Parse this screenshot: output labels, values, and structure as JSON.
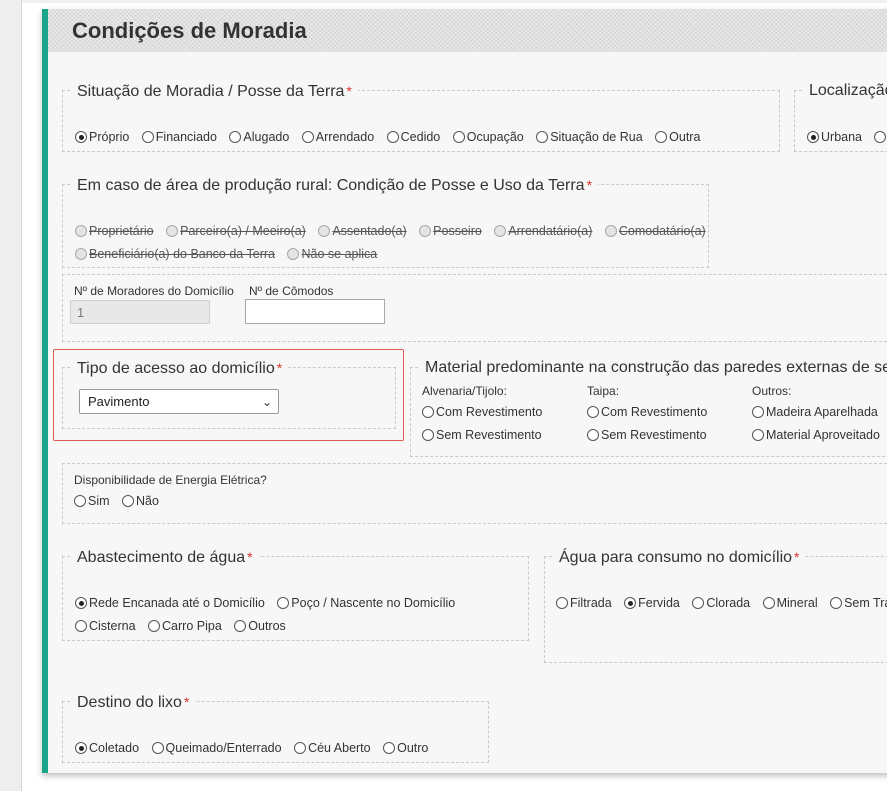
{
  "page_title": "Condições de Moradia",
  "situacao_moradia": {
    "legend": "Situação de Moradia / Posse da Terra",
    "options": [
      "Próprio",
      "Financiado",
      "Alugado",
      "Arrendado",
      "Cedido",
      "Ocupação",
      "Situação de Rua",
      "Outra"
    ],
    "selected": "Próprio"
  },
  "localizacao": {
    "legend": "Localização",
    "options": [
      "Urbana",
      ""
    ],
    "selected": "Urbana"
  },
  "area_rural": {
    "legend": "Em caso de área de produção rural: Condição de Posse e Uso da Terra",
    "options_row1": [
      "Proprietário",
      "Parceiro(a) / Meeiro(a)",
      "Assentado(a)",
      "Posseiro",
      "Arrendatário(a)",
      "Comodatário(a)"
    ],
    "options_row2": [
      "Beneficiário(a) do Banco da Terra",
      "Não se aplica"
    ]
  },
  "moradores": {
    "label": "Nº de Moradores do Domicílio",
    "value": "1"
  },
  "comodos": {
    "label": "Nº de Cômodos",
    "value": ""
  },
  "tipo_acesso": {
    "legend": "Tipo de acesso ao domicílio",
    "selected": "Pavimento"
  },
  "material_paredes": {
    "legend": "Material predominante na construção das paredes externas de seu do",
    "columns": [
      {
        "header": "Alvenaria/Tijolo:",
        "options": [
          "Com Revestimento",
          "Sem Revestimento"
        ]
      },
      {
        "header": "Taipa:",
        "options": [
          "Com Revestimento",
          "Sem Revestimento"
        ]
      },
      {
        "header": "Outros:",
        "options": [
          "Madeira Aparelhada",
          "Material Aproveitado"
        ]
      }
    ]
  },
  "energia": {
    "label": "Disponibilidade de Energia Elétrica?",
    "options": [
      "Sim",
      "Não"
    ]
  },
  "abastecimento": {
    "legend": "Abastecimento de água",
    "options_row1": [
      "Rede Encanada até o Domicílio",
      "Poço / Nascente no Domicílio"
    ],
    "options_row2": [
      "Cisterna",
      "Carro Pipa",
      "Outros"
    ],
    "selected": "Rede Encanada até o Domicílio"
  },
  "agua_consumo": {
    "legend": "Água para consumo no domicílio",
    "options": [
      "Filtrada",
      "Fervida",
      "Clorada",
      "Mineral",
      "Sem Trat"
    ],
    "selected": "Fervida"
  },
  "destino_lixo": {
    "legend": "Destino do lixo",
    "options": [
      "Coletado",
      "Queimado/Enterrado",
      "Céu Aberto",
      "Outro"
    ],
    "selected": "Coletado"
  }
}
